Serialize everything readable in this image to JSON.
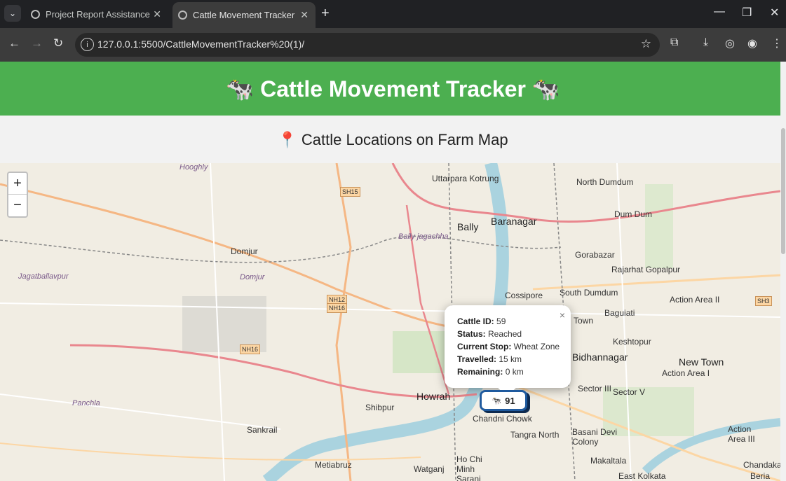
{
  "browser": {
    "tabs": [
      {
        "title": "Project Report Assistance",
        "active": false
      },
      {
        "title": "Cattle Movement Tracker",
        "active": true
      }
    ],
    "new_tab_label": "+",
    "url": "127.0.0.1:5500/CattleMovementTracker%20(1)/"
  },
  "page": {
    "header": "🐄 Cattle Movement Tracker 🐄",
    "subtitle": "📍 Cattle Locations on Farm Map"
  },
  "map": {
    "zoom_in": "+",
    "zoom_out": "−",
    "places": [
      "Uttarpara Kotrung",
      "North Dumdum",
      "Dum Dum",
      "Bally",
      "Baranagar",
      "Domjur",
      "Gorabazar",
      "Rajarhat Gopalpur",
      "Jagatballavpur",
      "Cossipore",
      "South Dumdum",
      "Action Area II",
      "Baguiati",
      "Keshtopur",
      "Bidhannagar",
      "New Town",
      "Action Area I",
      "Howrah",
      "Shibpur",
      "Sector III",
      "Sector V",
      "Chandni Chowk",
      "Tangra North",
      "Basani Devi Colony",
      "Panchla",
      "Sankrail",
      "Action Area III",
      "Metiabruz",
      "Watganj",
      "Ho Chi Minh Sarani",
      "Makaltala",
      "Chandakar",
      "East Kolkata",
      "Beria",
      "Town",
      "Bally jagachha",
      "Hooghly",
      "Domjur"
    ],
    "roads": [
      "SH15",
      "NH12",
      "NH16",
      "NH16",
      "SH3"
    ]
  },
  "popup": {
    "lines": [
      {
        "label": "Cattle ID:",
        "value": "59"
      },
      {
        "label": "Status:",
        "value": "Reached"
      },
      {
        "label": "Current Stop:",
        "value": "Wheat Zone"
      },
      {
        "label": "Travelled:",
        "value": "15 km"
      },
      {
        "label": "Remaining:",
        "value": "0 km"
      }
    ],
    "close": "×"
  },
  "marker": {
    "icon": "🐄",
    "count": "91"
  },
  "colors": {
    "header": "#4caf50",
    "marker_border": "#1f5a9e"
  }
}
